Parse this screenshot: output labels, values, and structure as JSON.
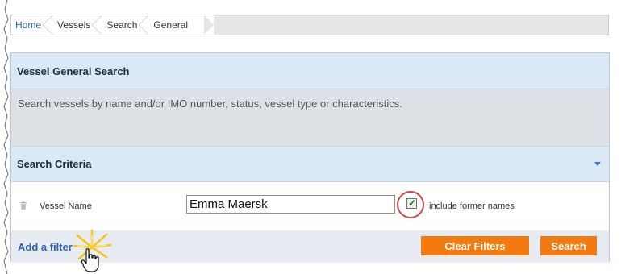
{
  "breadcrumb": [
    "Home",
    "Vessels",
    "Search",
    "General"
  ],
  "panel": {
    "title": "Vessel General Search",
    "description": "Search vessels by name and/or IMO number, status, vessel type or characteristics."
  },
  "criteria": {
    "title": "Search Criteria",
    "collapse_icon": "caret-down-icon",
    "filter": {
      "remove_icon": "trash-icon",
      "label": "Vessel Name",
      "value": "Emma Maersk",
      "include_former_names": {
        "checked": true,
        "label": "include former names"
      }
    }
  },
  "actions": {
    "add_filter": "Add a filter",
    "clear_filters": "Clear Filters",
    "search": "Search"
  },
  "colors": {
    "accent_orange": "#f37a0e",
    "header_blue": "#dbe9f7",
    "link_blue": "#2f63b8",
    "highlight_ring": "#c84a45"
  }
}
